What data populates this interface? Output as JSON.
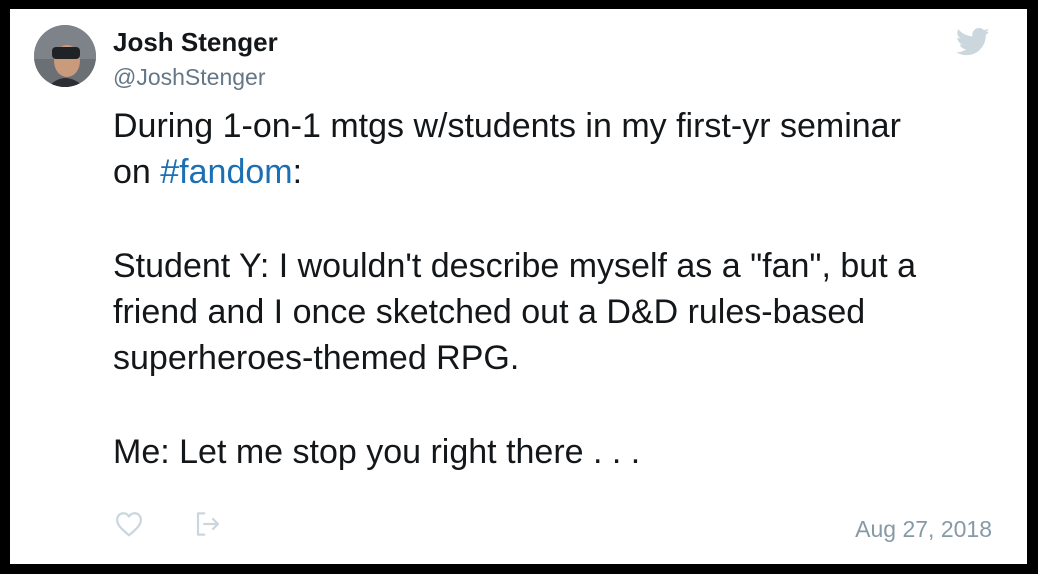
{
  "tweet": {
    "author": {
      "display_name": "Josh Stenger",
      "handle": "@JoshStenger"
    },
    "text": {
      "para1_line1": "During 1-on-1 mtgs w/students in my first-yr seminar",
      "para1_line2_prefix": "on ",
      "para1_hashtag": "#fandom",
      "para1_line2_suffix": ":",
      "para2_line1": "Student  Y: I wouldn't describe myself as a \"fan\", but a",
      "para2_line2": "friend and I once sketched out a D&D rules-based",
      "para2_line3": "superheroes-themed RPG.",
      "para3_line1": "Me: Let me stop you right there . . ."
    },
    "timestamp": "Aug 27, 2018"
  },
  "icons": {
    "brand": "twitter-bird-icon",
    "like": "heart-icon",
    "share": "share-icon"
  },
  "colors": {
    "background": "#ffffff",
    "frame": "#000000",
    "text": "#14171a",
    "hashtag": "#1b6fb4",
    "handle": "#657786",
    "muted": "#8899a6",
    "icon": "#ccd6dd"
  }
}
